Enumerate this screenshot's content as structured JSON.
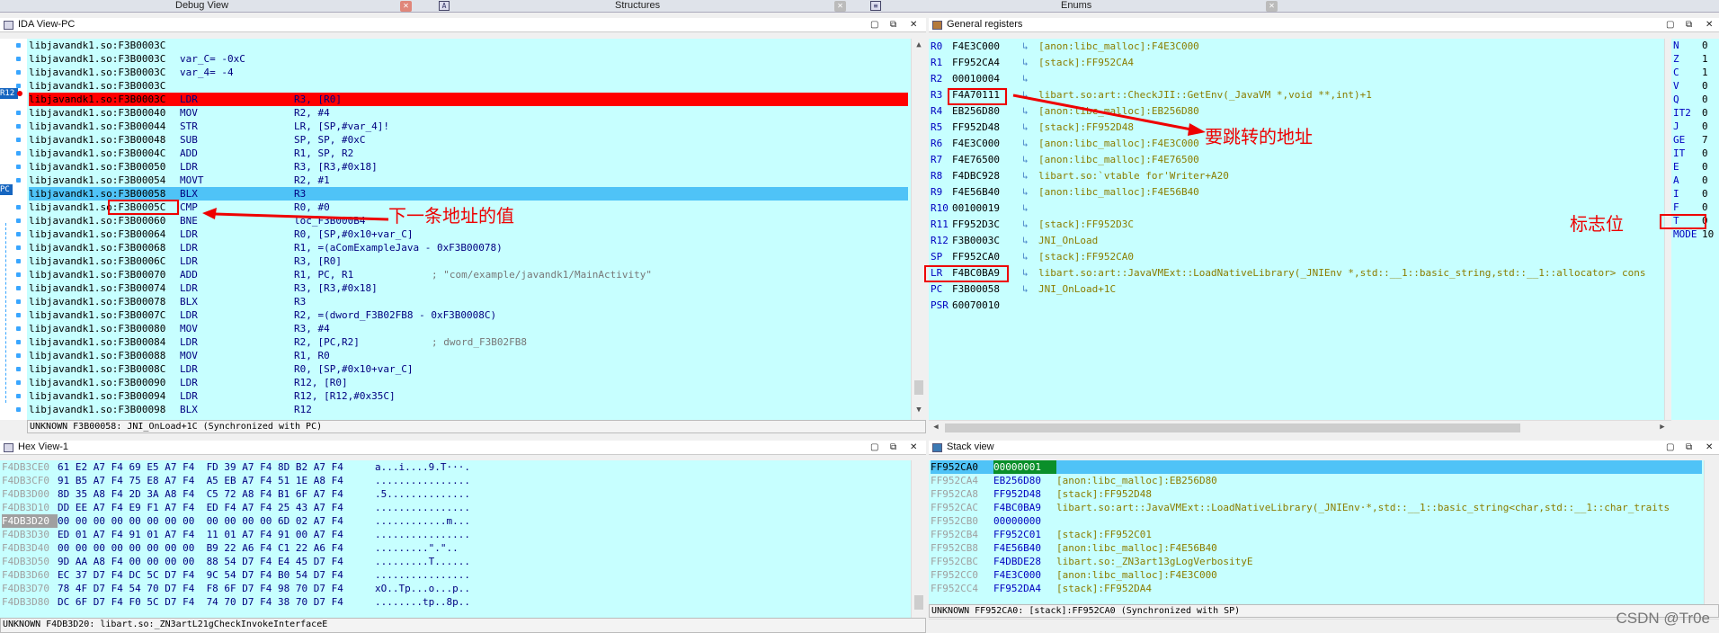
{
  "tabs": [
    {
      "label": "Debug View"
    },
    {
      "label": "Structures"
    },
    {
      "label": "Enums"
    }
  ],
  "ida": {
    "title": "IDA View-PC",
    "lines": [
      {
        "addr": "libjavandk1.so:F3B0003C",
        "mn": "",
        "op": "",
        "cm": ""
      },
      {
        "addr": "libjavandk1.so:F3B0003C",
        "mn": "var_C= -0xC",
        "op": "",
        "cm": ""
      },
      {
        "addr": "libjavandk1.so:F3B0003C",
        "mn": "var_4= -4",
        "op": "",
        "cm": ""
      },
      {
        "addr": "libjavandk1.so:F3B0003C",
        "mn": "",
        "op": "",
        "cm": ""
      },
      {
        "addr": "libjavandk1.so:F3B0003C",
        "mn": "LDR",
        "op": "R3, [R0]",
        "cm": ""
      },
      {
        "addr": "libjavandk1.so:F3B00040",
        "mn": "MOV",
        "op": "R2, #4",
        "cm": ""
      },
      {
        "addr": "libjavandk1.so:F3B00044",
        "mn": "STR",
        "op": "LR, [SP,#var_4]!",
        "cm": ""
      },
      {
        "addr": "libjavandk1.so:F3B00048",
        "mn": "SUB",
        "op": "SP, SP, #0xC",
        "cm": ""
      },
      {
        "addr": "libjavandk1.so:F3B0004C",
        "mn": "ADD",
        "op": "R1, SP, R2",
        "cm": ""
      },
      {
        "addr": "libjavandk1.so:F3B00050",
        "mn": "LDR",
        "op": "R3, [R3,#0x18]",
        "cm": ""
      },
      {
        "addr": "libjavandk1.so:F3B00054",
        "mn": "MOVT",
        "op": "R2, #1",
        "cm": ""
      },
      {
        "addr": "libjavandk1.so:F3B00058",
        "mn": "BLX",
        "op": "R3",
        "cm": ""
      },
      {
        "addr": "libjavandk1.so:F3B0005C",
        "mn": "CMP",
        "op": "R0, #0",
        "cm": ""
      },
      {
        "addr": "libjavandk1.so:F3B00060",
        "mn": "BNE",
        "op": "loc_F3B000B4",
        "cm": ""
      },
      {
        "addr": "libjavandk1.so:F3B00064",
        "mn": "LDR",
        "op": "R0, [SP,#0x10+var_C]",
        "cm": ""
      },
      {
        "addr": "libjavandk1.so:F3B00068",
        "mn": "LDR",
        "op": "R1, =(aComExampleJava - 0xF3B00078)",
        "cm": ""
      },
      {
        "addr": "libjavandk1.so:F3B0006C",
        "mn": "LDR",
        "op": "R3, [R0]",
        "cm": ""
      },
      {
        "addr": "libjavandk1.so:F3B00070",
        "mn": "ADD",
        "op": "R1, PC, R1",
        "cm": "; \"com/example/javandk1/MainActivity\""
      },
      {
        "addr": "libjavandk1.so:F3B00074",
        "mn": "LDR",
        "op": "R3, [R3,#0x18]",
        "cm": ""
      },
      {
        "addr": "libjavandk1.so:F3B00078",
        "mn": "BLX",
        "op": "R3",
        "cm": ""
      },
      {
        "addr": "libjavandk1.so:F3B0007C",
        "mn": "LDR",
        "op": "R2, =(dword_F3B02FB8 - 0xF3B0008C)",
        "cm": ""
      },
      {
        "addr": "libjavandk1.so:F3B00080",
        "mn": "MOV",
        "op": "R3, #4",
        "cm": ""
      },
      {
        "addr": "libjavandk1.so:F3B00084",
        "mn": "LDR",
        "op": "R2, [PC,R2]",
        "cm": "; dword_F3B02FB8"
      },
      {
        "addr": "libjavandk1.so:F3B00088",
        "mn": "MOV",
        "op": "R1, R0",
        "cm": ""
      },
      {
        "addr": "libjavandk1.so:F3B0008C",
        "mn": "LDR",
        "op": "R0, [SP,#0x10+var_C]",
        "cm": ""
      },
      {
        "addr": "libjavandk1.so:F3B00090",
        "mn": "LDR",
        "op": "R12, [R0]",
        "cm": ""
      },
      {
        "addr": "libjavandk1.so:F3B00094",
        "mn": "LDR",
        "op": "R12, [R12,#0x35C]",
        "cm": ""
      },
      {
        "addr": "libjavandk1.so:F3B00098",
        "mn": "BLX",
        "op": "R12",
        "cm": ""
      }
    ],
    "gutter_r12": "R12",
    "gutter_pc": "PC",
    "status": "UNKNOWN F3B00058: JNI_OnLoad+1C (Synchronized with PC)",
    "annotation": "下一条地址的值"
  },
  "regs": {
    "title": "General registers",
    "rows": [
      {
        "n": "R0",
        "v": "F4E3C000",
        "arrow": "↳",
        "t": "[anon:libc_malloc]:F4E3C000"
      },
      {
        "n": "R1",
        "v": "FF952CA4",
        "arrow": "↳",
        "t": "[stack]:FF952CA4"
      },
      {
        "n": "R2",
        "v": "00010004",
        "arrow": "↳",
        "t": ""
      },
      {
        "n": "R3",
        "v": "F4A70111",
        "arrow": "↳",
        "t": "libart.so:art::CheckJII::GetEnv(_JavaVM *,void **,int)+1"
      },
      {
        "n": "R4",
        "v": "EB256D80",
        "arrow": "↳",
        "t": "[anon:libc_malloc]:EB256D80"
      },
      {
        "n": "R5",
        "v": "FF952D48",
        "arrow": "↳",
        "t": "[stack]:FF952D48"
      },
      {
        "n": "R6",
        "v": "F4E3C000",
        "arrow": "↳",
        "t": "[anon:libc_malloc]:F4E3C000"
      },
      {
        "n": "R7",
        "v": "F4E76500",
        "arrow": "↳",
        "t": "[anon:libc_malloc]:F4E76500"
      },
      {
        "n": "R8",
        "v": "F4DBC928",
        "arrow": "↳",
        "t": "libart.so:`vtable for'Writer+A20"
      },
      {
        "n": "R9",
        "v": "F4E56B40",
        "arrow": "↳",
        "t": "[anon:libc_malloc]:F4E56B40"
      },
      {
        "n": "R10",
        "v": "00100019",
        "arrow": "↳",
        "t": ""
      },
      {
        "n": "R11",
        "v": "FF952D3C",
        "arrow": "↳",
        "t": "[stack]:FF952D3C"
      },
      {
        "n": "R12",
        "v": "F3B0003C",
        "arrow": "↳",
        "t": "JNI_OnLoad"
      },
      {
        "n": "SP",
        "v": "FF952CA0",
        "arrow": "↳",
        "t": "[stack]:FF952CA0"
      },
      {
        "n": "LR",
        "v": "F4BC0BA9",
        "arrow": "↳",
        "t": "libart.so:art::JavaVMExt::LoadNativeLibrary(_JNIEnv *,std::__1::basic_string,std::__1::allocator> cons"
      },
      {
        "n": "PC",
        "v": "F3B00058",
        "arrow": "↳",
        "t": "JNI_OnLoad+1C"
      },
      {
        "n": "PSR",
        "v": "60070010",
        "arrow": "",
        "t": ""
      }
    ],
    "annotation_jump": "要跳转的地址",
    "annotation_flags": "标志位"
  },
  "flags": [
    {
      "n": "N",
      "v": "0"
    },
    {
      "n": "Z",
      "v": "1"
    },
    {
      "n": "C",
      "v": "1"
    },
    {
      "n": "V",
      "v": "0"
    },
    {
      "n": "Q",
      "v": "0"
    },
    {
      "n": "IT2",
      "v": "0"
    },
    {
      "n": "J",
      "v": "0"
    },
    {
      "n": "GE",
      "v": "7"
    },
    {
      "n": "IT",
      "v": "0"
    },
    {
      "n": "E",
      "v": "0"
    },
    {
      "n": "A",
      "v": "0"
    },
    {
      "n": "I",
      "v": "0"
    },
    {
      "n": "F",
      "v": "0"
    },
    {
      "n": "T",
      "v": "0"
    },
    {
      "n": "MODE",
      "v": "10"
    }
  ],
  "hex": {
    "title": "Hex View-1",
    "rows": [
      {
        "a": "F4DB3CE0",
        "b": "61 E2 A7 F4 69 E5 A7 F4  FD 39 A7 F4 8D B2 A7 F4",
        "s": "a...i....9.Т···."
      },
      {
        "a": "F4DB3CF0",
        "b": "91 B5 A7 F4 75 E8 A7 F4  A5 EB A7 F4 51 1E A8 F4",
        "s": "................"
      },
      {
        "a": "F4DB3D00",
        "b": "8D 35 A8 F4 2D 3A A8 F4  C5 72 A8 F4 B1 6F A7 F4",
        "s": ".5.............."
      },
      {
        "a": "F4DB3D10",
        "b": "DD EE A7 F4 E9 F1 A7 F4  ED F4 A7 F4 25 43 A7 F4",
        "s": "................"
      },
      {
        "a": "F4DB3D20",
        "b": "00 00 00 00 00 00 00 00  00 00 00 00 6D 02 A7 F4",
        "s": "............m..."
      },
      {
        "a": "F4DB3D30",
        "b": "ED 01 A7 F4 91 01 A7 F4  11 01 A7 F4 91 00 A7 F4",
        "s": "................"
      },
      {
        "a": "F4DB3D40",
        "b": "00 00 00 00 00 00 00 00  B9 22 A6 F4 C1 22 A6 F4",
        "s": ".........\".\".."
      },
      {
        "a": "F4DB3D50",
        "b": "9D AA A8 F4 00 00 00 00  88 54 D7 F4 E4 45 D7 F4",
        "s": ".........T......"
      },
      {
        "a": "F4DB3D60",
        "b": "EC 37 D7 F4 DC 5C D7 F4  9C 54 D7 F4 B0 54 D7 F4",
        "s": "................"
      },
      {
        "a": "F4DB3D70",
        "b": "78 4F D7 F4 54 70 D7 F4  F8 6F D7 F4 98 70 D7 F4",
        "s": "xO..Tp...o...p.."
      },
      {
        "a": "F4DB3D80",
        "b": "DC 6F D7 F4 F0 5C D7 F4  74 70 D7 F4 38 70 D7 F4",
        "s": "........tp..8p.."
      }
    ],
    "status": "UNKNOWN F4DB3D20: libart.so:_ZN3artL21gCheckInvokeInterfaceE"
  },
  "stack": {
    "title": "Stack view",
    "rows": [
      {
        "a": "FF952CA0",
        "v": "00000001",
        "d": ""
      },
      {
        "a": "FF952CA4",
        "v": "EB256D80",
        "d": "[anon:libc_malloc]:EB256D80"
      },
      {
        "a": "FF952CA8",
        "v": "FF952D48",
        "d": "[stack]:FF952D48"
      },
      {
        "a": "FF952CAC",
        "v": "F4BC0BA9",
        "d": "libart.so:art::JavaVMExt::LoadNativeLibrary(_JNIEnv·*,std::__1::basic_string<char,std::__1::char_traits"
      },
      {
        "a": "FF952CB0",
        "v": "00000000",
        "d": ""
      },
      {
        "a": "FF952CB4",
        "v": "FF952C01",
        "d": "[stack]:FF952C01"
      },
      {
        "a": "FF952CB8",
        "v": "F4E56B40",
        "d": "[anon:libc_malloc]:F4E56B40"
      },
      {
        "a": "FF952CBC",
        "v": "F4DBDE28",
        "d": "libart.so:_ZN3art13gLogVerbosityE"
      },
      {
        "a": "FF952CC0",
        "v": "F4E3C000",
        "d": "[anon:libc_malloc]:F4E3C000"
      },
      {
        "a": "FF952CC4",
        "v": "FF952DA4",
        "d": "[stack]:FF952DA4"
      }
    ],
    "status": "UNKNOWN FF952CA0: [stack]:FF952CA0 (Synchronized with SP)"
  },
  "watermark": "CSDN @Tr0e",
  "colors": {
    "accent_red": "#ff0000",
    "pc_blue": "#4fc3f7",
    "panel_bg": "#c7ffff"
  }
}
